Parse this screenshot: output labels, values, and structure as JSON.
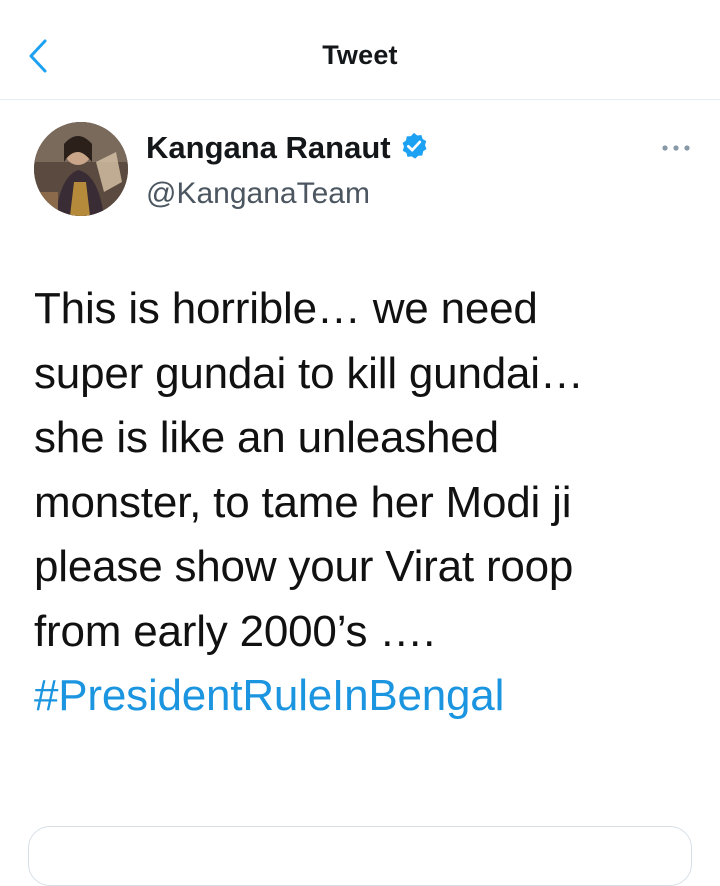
{
  "header": {
    "title": "Tweet",
    "back_icon": "chevron-left-icon"
  },
  "author": {
    "name": "Kangana Ranaut",
    "handle": "@KanganaTeam",
    "verified": true,
    "verified_color": "#1da1f2"
  },
  "tweet": {
    "text": "This is horrible… we need\nsuper gundai to kill gundai…\nshe is like an unleashed\nmonster, to tame her Modi ji\nplease show your Virat roop\nfrom early 2000’s ….",
    "hashtag": "#PresidentRuleInBengal",
    "hashtag_color": "#1b95e0"
  },
  "colors": {
    "accent": "#1da1f2",
    "divider": "#e6ecf0"
  }
}
